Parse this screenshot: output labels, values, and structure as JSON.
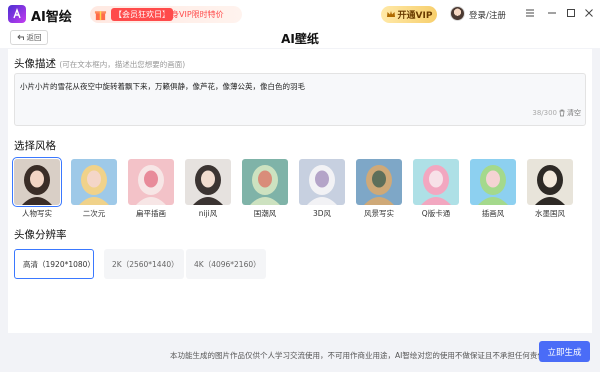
{
  "app": {
    "name": "AI智绘",
    "promo_tag": "【会员狂欢日】",
    "promo_text": "终身VIP限时特价",
    "vip_button": "开通VIP",
    "login": "登录/注册"
  },
  "header": {
    "back_label": "返回",
    "title": "AI壁纸"
  },
  "description": {
    "label": "头像描述",
    "hint": "(可在文本框内，描述出您想要的画面)",
    "value": "小片小片的雪花从夜空中旋转着飘下来，万籁俱静，像芦花，像薄公英，像白色的羽毛",
    "count": "38/300",
    "clear_label": "清空"
  },
  "styles": {
    "label": "选择风格",
    "selected": "人物写实",
    "items": [
      {
        "label": "人物写实",
        "colors": [
          "#d9cfc6",
          "#3a2d27",
          "#f2d5c4"
        ]
      },
      {
        "label": "二次元",
        "colors": [
          "#9ec9e8",
          "#f0d28a",
          "#f4d6c8"
        ]
      },
      {
        "label": "扁平插画",
        "colors": [
          "#f3c2c8",
          "#f7e6e6",
          "#e88b9a"
        ]
      },
      {
        "label": "niji风",
        "colors": [
          "#e6e2df",
          "#3b3432",
          "#f1dccf"
        ]
      },
      {
        "label": "国潮风",
        "colors": [
          "#7fb3a8",
          "#cde2c0",
          "#d98d7a"
        ]
      },
      {
        "label": "3D风",
        "colors": [
          "#c7d0e0",
          "#f2f2f5",
          "#b4a4c8"
        ]
      },
      {
        "label": "风景写实",
        "colors": [
          "#7ea7c7",
          "#cfa978",
          "#5e6f5a"
        ]
      },
      {
        "label": "Q版卡通",
        "colors": [
          "#aee0e6",
          "#f2a7c0",
          "#f7e1e8"
        ]
      },
      {
        "label": "插画风",
        "colors": [
          "#8dd0f0",
          "#a4d98c",
          "#f4d3d3"
        ]
      },
      {
        "label": "水墨国风",
        "colors": [
          "#e8e4da",
          "#2e2a26",
          "#f3e9dc"
        ]
      }
    ]
  },
  "resolution": {
    "label": "头像分辨率",
    "options": [
      {
        "label": "高清（1920*1080）",
        "selected": true
      },
      {
        "label": "2K（2560*1440）",
        "selected": false
      },
      {
        "label": "4K（4096*2160）",
        "selected": false
      }
    ]
  },
  "footer": {
    "disclaimer": "本功能生成的图片作品仅供个人学习交流使用，不可用作商业用途，AI智绘对您的使用不做保证且不承担任何责任",
    "generate_label": "立即生成"
  },
  "colors": {
    "accent": "#4a6cf7",
    "selected_border": "#3a78ff",
    "promo_red": "#ff4b4b"
  }
}
